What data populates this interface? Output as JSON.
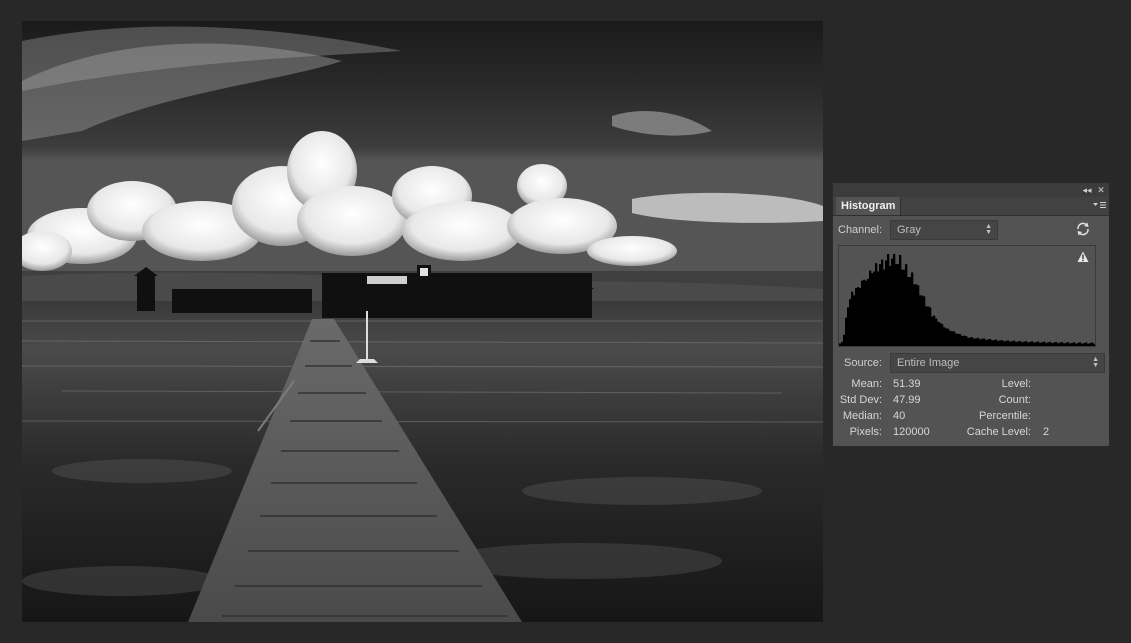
{
  "panel": {
    "tab_label": "Histogram",
    "collapse_glyph": "◂◂",
    "close_glyph": "✕",
    "channel_label": "Channel:",
    "channel_value": "Gray",
    "source_label": "Source:",
    "source_value": "Entire Image"
  },
  "stats": {
    "mean_label": "Mean:",
    "mean_value": "51.39",
    "stddev_label": "Std Dev:",
    "stddev_value": "47.99",
    "median_label": "Median:",
    "median_value": "40",
    "pixels_label": "Pixels:",
    "pixels_value": "120000",
    "level_label": "Level:",
    "count_label": "Count:",
    "percentile_label": "Percentile:",
    "cache_label": "Cache Level:",
    "cache_value": "2"
  },
  "histogram_shape": [
    0.02,
    0.05,
    0.12,
    0.3,
    0.45,
    0.5,
    0.55,
    0.58,
    0.62,
    0.6,
    0.66,
    0.7,
    0.68,
    0.74,
    0.72,
    0.78,
    0.82,
    0.8,
    0.86,
    0.84,
    0.88,
    0.9,
    0.86,
    0.92,
    0.96,
    0.9,
    0.94,
    1.0,
    0.92,
    0.88,
    0.95,
    0.86,
    0.82,
    0.85,
    0.78,
    0.74,
    0.76,
    0.7,
    0.66,
    0.62,
    0.58,
    0.54,
    0.5,
    0.46,
    0.42,
    0.38,
    0.35,
    0.32,
    0.29,
    0.27,
    0.25,
    0.23,
    0.21,
    0.19,
    0.18,
    0.17,
    0.16,
    0.15,
    0.14,
    0.13,
    0.12,
    0.115,
    0.11,
    0.1,
    0.095,
    0.09,
    0.088,
    0.085,
    0.082,
    0.08,
    0.078,
    0.076,
    0.074,
    0.072,
    0.07,
    0.068,
    0.066,
    0.064,
    0.062,
    0.06,
    0.058,
    0.056,
    0.055,
    0.054,
    0.053,
    0.052,
    0.05,
    0.05,
    0.049,
    0.048,
    0.047,
    0.046,
    0.045,
    0.045,
    0.044,
    0.043,
    0.042,
    0.042,
    0.041,
    0.04,
    0.04,
    0.04,
    0.039,
    0.038,
    0.038,
    0.037,
    0.037,
    0.036,
    0.036,
    0.035,
    0.035,
    0.034,
    0.034,
    0.033,
    0.033,
    0.033,
    0.032,
    0.032,
    0.032,
    0.031,
    0.031,
    0.031,
    0.03,
    0.03,
    0.03,
    0.03,
    0.03,
    0.03
  ],
  "colors": {
    "panel_bg": "#535353",
    "histogram_fill": "#000000",
    "app_bg": "#282828"
  }
}
